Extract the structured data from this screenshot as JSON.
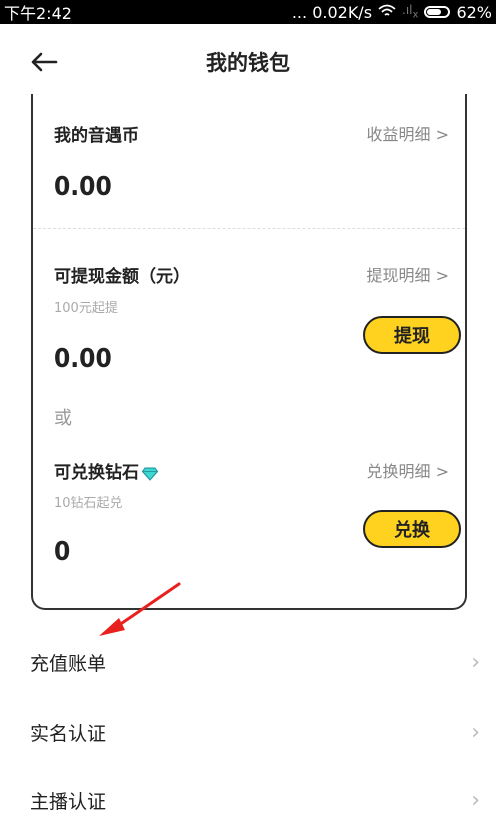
{
  "status_bar": {
    "time": "下午2:42",
    "network": "... 0.02K/s",
    "battery": "62%"
  },
  "header": {
    "title": "我的钱包",
    "back_icon": "arrow-left-icon"
  },
  "wallet": {
    "coins_label": "我的音遇币",
    "coins_link": "收益明细 >",
    "coins_value": "0.00",
    "withdraw_label": "可提现金额（元）",
    "withdraw_sub": "100元起提",
    "withdraw_link": "提现明细 >",
    "withdraw_value": "0.00",
    "withdraw_button": "提现",
    "or_text": "或",
    "diamond_label": "可兑换钻石",
    "diamond_sub": "10钻石起兑",
    "diamond_link": "兑换明细 >",
    "diamond_value": "0",
    "exchange_button": "兑换"
  },
  "menu": [
    {
      "label": "充值账单"
    },
    {
      "label": "实名认证"
    },
    {
      "label": "主播认证"
    }
  ],
  "colors": {
    "accent_yellow": "#ffd21f",
    "annotation_red": "#e8211e"
  }
}
